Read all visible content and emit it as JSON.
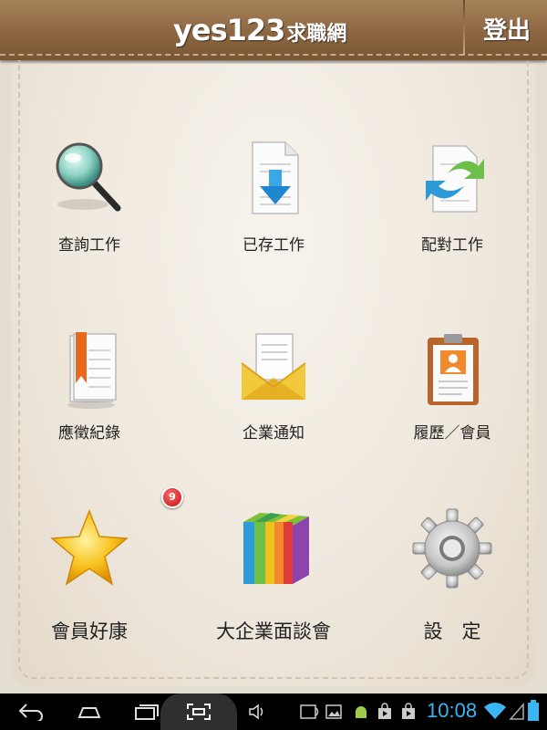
{
  "header": {
    "brand_main": "yes123",
    "brand_sub": "求職網",
    "logout_label": "登出"
  },
  "menu": {
    "row1": [
      {
        "label": "查詢工作",
        "icon": "magnifier-icon"
      },
      {
        "label": "已存工作",
        "icon": "download-document-icon"
      },
      {
        "label": "配對工作",
        "icon": "match-arrows-icon"
      }
    ],
    "row2": [
      {
        "label": "應徵紀錄",
        "icon": "bookmark-document-icon"
      },
      {
        "label": "企業通知",
        "icon": "envelope-letter-icon"
      },
      {
        "label": "履歷／會員",
        "icon": "clipboard-resume-icon"
      }
    ],
    "row3": [
      {
        "label": "會員好康",
        "icon": "star-icon",
        "badge": "9"
      },
      {
        "label": "大企業面談會",
        "icon": "color-blocks-icon"
      },
      {
        "label": "設　定",
        "icon": "gear-icon"
      }
    ]
  },
  "status_bar": {
    "time": "10:08"
  },
  "colors": {
    "header_brown": "#8a6440",
    "panel_beige": "#efe8dd",
    "clock_blue": "#3bb6f3",
    "badge_red": "#d11414"
  }
}
